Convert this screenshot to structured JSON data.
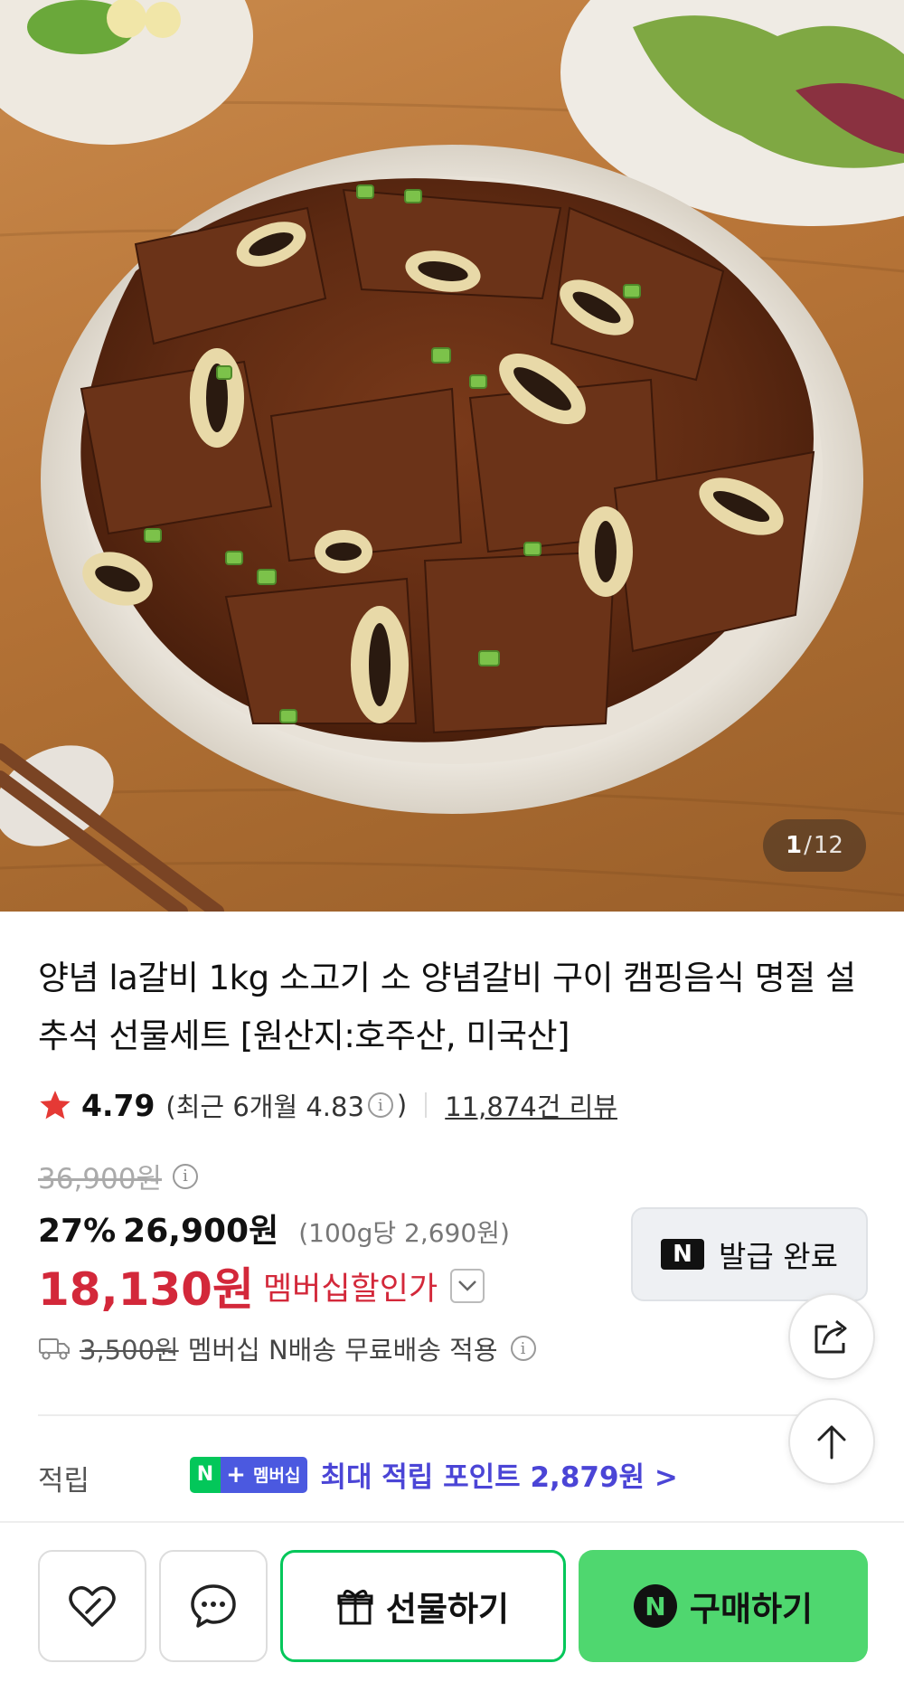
{
  "gallery": {
    "current": "1",
    "separator": "/",
    "total": "12",
    "image_description_name": "product-photo"
  },
  "product": {
    "title": "양념 la갈비 1kg 소고기 소 양념갈비 구이 캠핑음식 명절 설 추석 선물세트 [원산지:호주산, 미국산]"
  },
  "rating": {
    "score": "4.79",
    "recent_prefix": "(최근 6개월 4.83",
    "recent_suffix": ")",
    "review_count": "11,874건 리뷰"
  },
  "price": {
    "original": "36,900원",
    "discount_percent": "27%",
    "sale_price": "26,900원",
    "unit_price": "(100g당 2,690원)",
    "member_price": "18,130원",
    "member_label": "멤버십할인가"
  },
  "coupon": {
    "logo": "N",
    "label": "발급 완료"
  },
  "shipping": {
    "fee": "3,500원",
    "note": "멤버십 N배송 무료배송 적용"
  },
  "points": {
    "label": "적립",
    "badge_n": "N",
    "badge_plus": "+",
    "badge_membership": "멤버십",
    "text": "최대 적립 포인트 2,879원 >"
  },
  "actions": {
    "gift_label": "선물하기",
    "buy_logo": "N",
    "buy_label": "구매하기"
  },
  "colors": {
    "member_price": "#d3283a",
    "points_text": "#4b45d6",
    "naver_green": "#03c75a",
    "buy_button": "#4fd76f",
    "star": "#e53935"
  },
  "icons": [
    "share-icon",
    "arrow-up-icon",
    "heart-icon",
    "chat-icon",
    "gift-icon",
    "truck-icon",
    "star-icon",
    "info-icon",
    "chevron-down-icon"
  ]
}
